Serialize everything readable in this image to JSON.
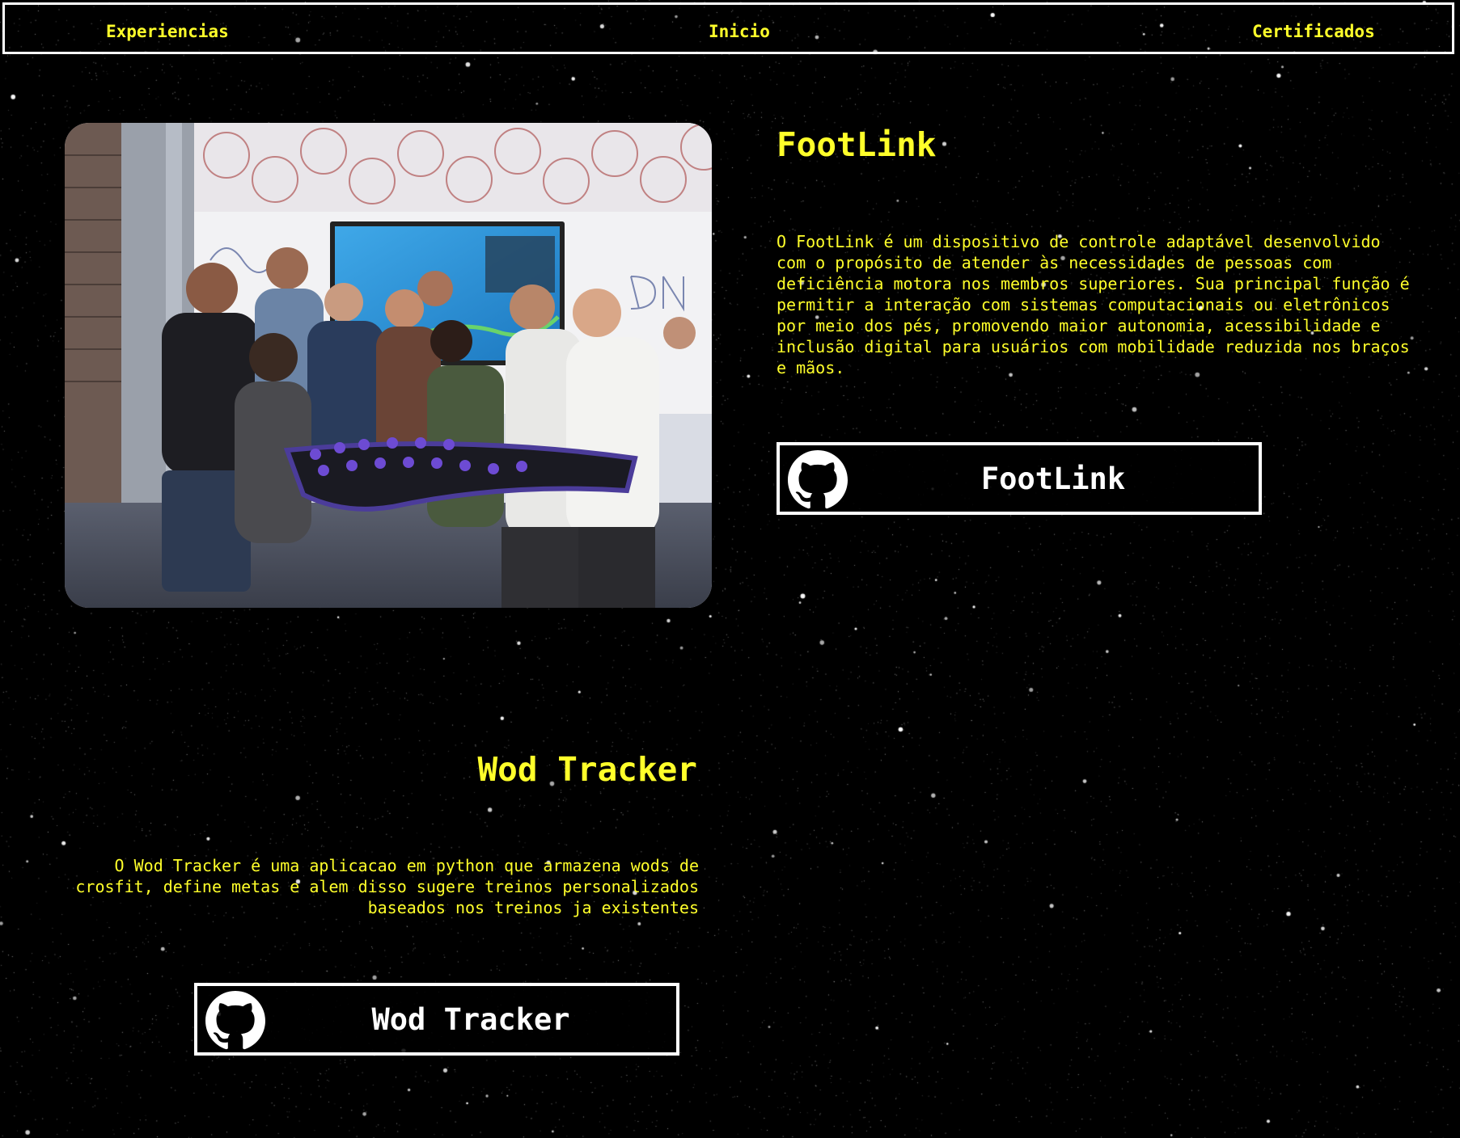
{
  "nav": {
    "experiences": "Experiencias",
    "home": "Inicio",
    "certificates": "Certificados"
  },
  "projects": [
    {
      "title": "FootLink",
      "description": "O FootLink é um dispositivo de controle adaptável desenvolvido com o propósito de atender às necessidades de pessoas com deficiência motora nos membros superiores. Sua principal função é permitir a interação com sistemas computacionais ou eletrônicos por meio dos pés, promovendo maior autonomia, acessibilidade e inclusão digital para usuários com mobilidade reduzida nos braços e mãos.",
      "button_label": "FootLink",
      "button_icon": "github-icon"
    },
    {
      "title": "Wod Tracker",
      "description": "O Wod Tracker é uma aplicacao em python que armazena wods de crosfit, define metas e alem disso sugere treinos personalizados baseados nos treinos ja existentes",
      "button_label": "Wod Tracker",
      "button_icon": "github-icon"
    }
  ],
  "colors": {
    "background": "#000000",
    "accent": "#ffff2a",
    "button_text": "#ffffff"
  }
}
